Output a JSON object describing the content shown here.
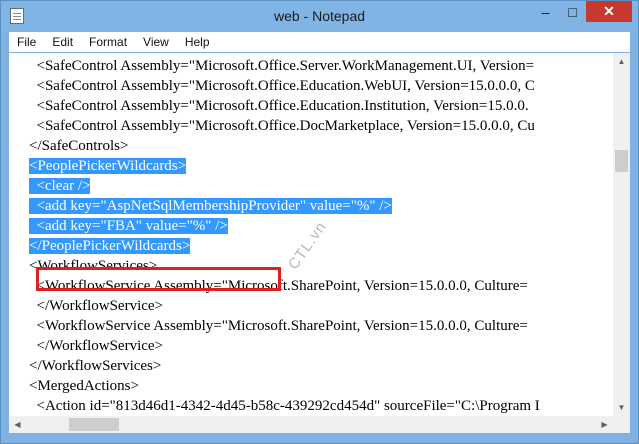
{
  "window": {
    "title": "web - Notepad",
    "minimize_glyph": "–",
    "maximize_glyph": "□",
    "close_glyph": "✕",
    "icon": "notepad-icon"
  },
  "menu": [
    "File",
    "Edit",
    "Format",
    "View",
    "Help"
  ],
  "lines": [
    "  <SafeControl Assembly=\"Microsoft.Office.Server.WorkManagement.UI, Version=",
    "  <SafeControl Assembly=\"Microsoft.Office.Education.WebUI, Version=15.0.0.0, C",
    "  <SafeControl Assembly=\"Microsoft.Office.Education.Institution, Version=15.0.0.",
    "  <SafeControl Assembly=\"Microsoft.Office.DocMarketplace, Version=15.0.0.0, Cu",
    "</SafeControls>",
    "<PeoplePickerWildcards>",
    "  <clear />",
    "  <add key=\"AspNetSqlMembershipProvider\" value=\"%\" />",
    "  <add key=\"FBA\" value=\"%\" />",
    "</PeoplePickerWildcards>",
    "<WorkflowServices>",
    "  <WorkflowService Assembly=\"Microsoft.SharePoint, Version=15.0.0.0, Culture=",
    "  </WorkflowService>",
    "  <WorkflowService Assembly=\"Microsoft.SharePoint, Version=15.0.0.0, Culture=",
    "  </WorkflowService>",
    "</WorkflowServices>",
    "<MergedActions>",
    "  <Action id=\"813d46d1-4342-4d45-b58c-439292cd454d\" sourceFile=\"C:\\Program I"
  ],
  "selected_lines": [
    5,
    6,
    7,
    8,
    9
  ],
  "highlighted_line": 8,
  "watermark": "CTL.vn",
  "colors": {
    "selection": "#3399ff",
    "titlebar": "#80b4e4",
    "close_button": "#c7392f",
    "highlight_box": "#e02020"
  }
}
